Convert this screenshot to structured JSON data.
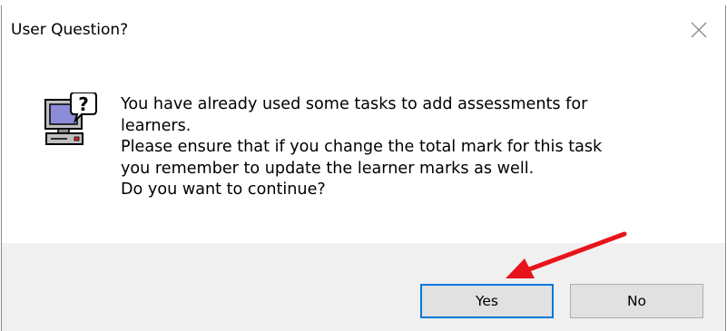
{
  "dialog": {
    "title": "User Question?",
    "message_lines": [
      "You have already used some tasks to add assessments for",
      "learners.",
      "Please ensure that if you change the total mark for this task",
      "you remember to update the learner marks as well.",
      "Do you want to continue?"
    ],
    "icon": "computer-question-icon",
    "yes_label": "Yes",
    "no_label": "No"
  },
  "annotation": {
    "arrow": "red-arrow-pointing-to-yes",
    "color": "#e8141b"
  }
}
